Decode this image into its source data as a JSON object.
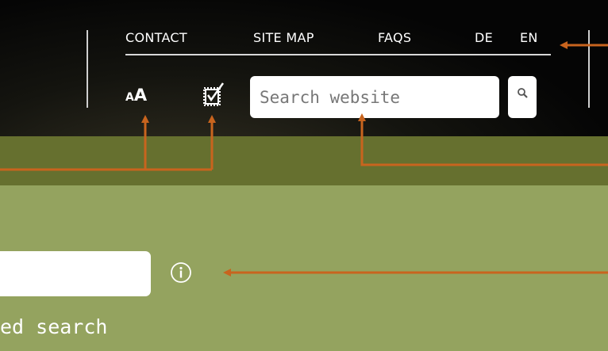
{
  "header": {
    "links": [
      {
        "label": "CONTACT"
      },
      {
        "label": "SITE MAP"
      },
      {
        "label": "FAQS"
      }
    ],
    "languages": [
      {
        "label": "DE"
      },
      {
        "label": "EN"
      }
    ],
    "font_size_label_small": "A",
    "font_size_label_big": "A",
    "accessibility_icon": "checkbox-icon",
    "search": {
      "placeholder": "Search website",
      "value": "",
      "icon": "magnifier-icon"
    }
  },
  "content": {
    "search_field_value": "",
    "info_icon": "info-circle-icon",
    "advanced_search_label": "ed search"
  },
  "colors": {
    "header_bg": "#050505",
    "band_dark": "#66702f",
    "band_light": "#94a35f",
    "annotation_arrow": "#c8641e"
  }
}
